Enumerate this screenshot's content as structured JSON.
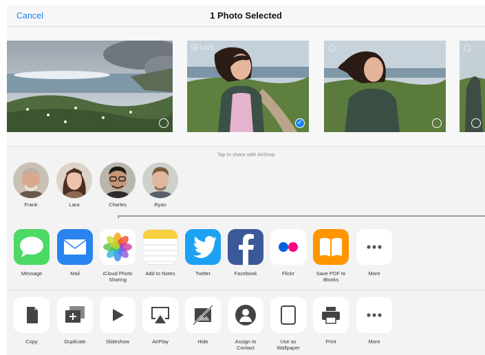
{
  "header": {
    "cancel_label": "Cancel",
    "title": "1 Photo Selected"
  },
  "photos": [
    {
      "scene": "seascape",
      "selected": false
    },
    {
      "scene": "woman-smiling",
      "selected": true,
      "badge": "LIVE"
    },
    {
      "scene": "woman-windy",
      "selected": false
    },
    {
      "scene": "partial-person",
      "selected": false
    }
  ],
  "airdrop": {
    "hint": "Tap to share with AirDrop",
    "people": [
      {
        "name": "Frank"
      },
      {
        "name": "Lara"
      },
      {
        "name": "Charles"
      },
      {
        "name": "Ryan"
      }
    ]
  },
  "share_apps": [
    {
      "label": "Message",
      "icon": "message-icon",
      "color": "#4cd964"
    },
    {
      "label": "Mail",
      "icon": "mail-icon",
      "color": "#2a84f0"
    },
    {
      "label_line1": "iCloud Photo",
      "label_line2": "Sharing",
      "icon": "photos-icon",
      "color": "#ffffff"
    },
    {
      "label": "Add to Notes",
      "icon": "notes-icon",
      "color": "#ffffff"
    },
    {
      "label": "Twitter",
      "icon": "twitter-icon",
      "color": "#1da1f2"
    },
    {
      "label": "Facebook",
      "icon": "facebook-icon",
      "color": "#3b5998"
    },
    {
      "label": "Flickr",
      "icon": "flickr-icon",
      "color": "#ffffff"
    },
    {
      "label_line1": "Save PDF to",
      "label_line2": "iBooks",
      "icon": "ibooks-icon",
      "color": "#ff9500"
    },
    {
      "label": "More",
      "icon": "more-icon",
      "color": "#ffffff"
    }
  ],
  "actions": [
    {
      "label": "Copy",
      "icon": "copy-icon"
    },
    {
      "label": "Duplicate",
      "icon": "duplicate-icon"
    },
    {
      "label": "Slideshow",
      "icon": "play-icon"
    },
    {
      "label": "AirPlay",
      "icon": "airplay-icon"
    },
    {
      "label": "Hide",
      "icon": "hide-icon"
    },
    {
      "label_line1": "Assign to",
      "label_line2": "Contact",
      "icon": "contact-icon"
    },
    {
      "label_line1": "Use as",
      "label_line2": "Wallpaper",
      "icon": "wallpaper-icon"
    },
    {
      "label": "Print",
      "icon": "print-icon"
    },
    {
      "label": "More",
      "icon": "more-icon"
    }
  ]
}
